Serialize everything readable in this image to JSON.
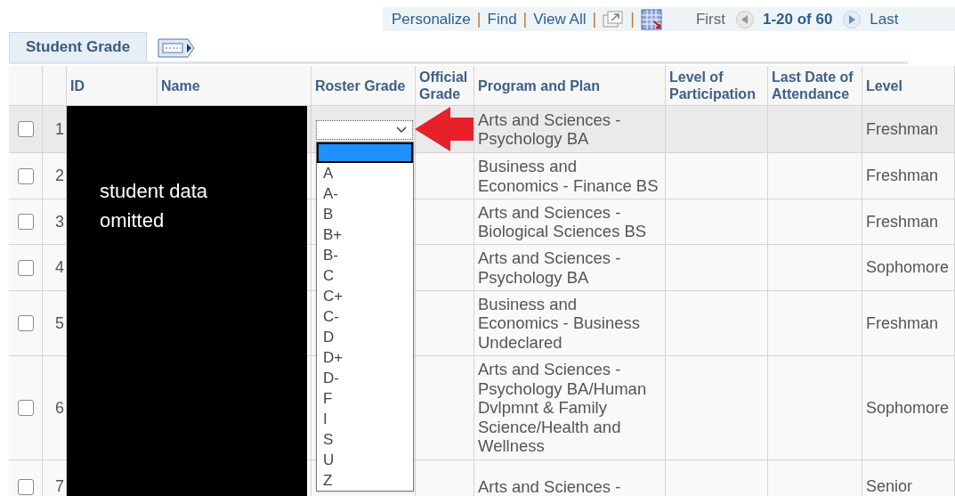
{
  "toolbar": {
    "links": [
      "Personalize",
      "Find",
      "View All"
    ],
    "separator": "|",
    "first": "First",
    "range": "1-20 of 60",
    "last": "Last"
  },
  "tabs": [
    {
      "label": "Student Grade",
      "selected": true
    }
  ],
  "table": {
    "columns": [
      "ID",
      "Name",
      "Roster Grade",
      "Official Grade",
      "Program and Plan",
      "Level of Participation",
      "Last Date of Attendance",
      "Level"
    ],
    "rows": [
      {
        "number": "1",
        "checked": false,
        "highlighted": true,
        "program": "Arts and Sciences - Psychology BA",
        "level": "Freshman"
      },
      {
        "number": "2",
        "checked": false,
        "highlighted": false,
        "program": "Business and Economics - Finance BS",
        "level": "Freshman"
      },
      {
        "number": "3",
        "checked": false,
        "highlighted": false,
        "program": "Arts and Sciences - Biological Sciences BS",
        "level": "Freshman"
      },
      {
        "number": "4",
        "checked": false,
        "highlighted": false,
        "program": "Arts and Sciences - Psychology BA",
        "level": "Sophomore"
      },
      {
        "number": "5",
        "checked": false,
        "highlighted": false,
        "program": "Business and Economics - Business Undeclared",
        "level": "Freshman"
      },
      {
        "number": "6",
        "checked": false,
        "highlighted": false,
        "program": "Arts and Sciences - Psychology BA/Human Dvlpmnt & Family Science/Health and Wellness",
        "level": "Sophomore"
      },
      {
        "number": "7",
        "checked": false,
        "highlighted": false,
        "program": "Arts and Sciences -",
        "level": "Senior"
      }
    ]
  },
  "grade_dropdown": {
    "expanded": true,
    "options": [
      {
        "selected": true
      },
      {
        "label": "A",
        "selected": false
      },
      {
        "label": "A-",
        "selected": false
      },
      {
        "label": "B",
        "selected": false
      },
      {
        "label": "B+",
        "selected": false
      },
      {
        "label": "B-",
        "selected": false
      },
      {
        "label": "C",
        "selected": false
      },
      {
        "label": "C+",
        "selected": false
      },
      {
        "label": "C-",
        "selected": false
      },
      {
        "label": "D",
        "selected": false
      },
      {
        "label": "D+",
        "selected": false
      },
      {
        "label": "D-",
        "selected": false
      },
      {
        "label": "F",
        "selected": false
      },
      {
        "label": "I",
        "selected": false
      },
      {
        "label": "S",
        "selected": false
      },
      {
        "label": "U",
        "selected": false
      },
      {
        "label": "Z",
        "selected": false
      }
    ]
  },
  "redaction": {
    "note": "student data omitted"
  }
}
